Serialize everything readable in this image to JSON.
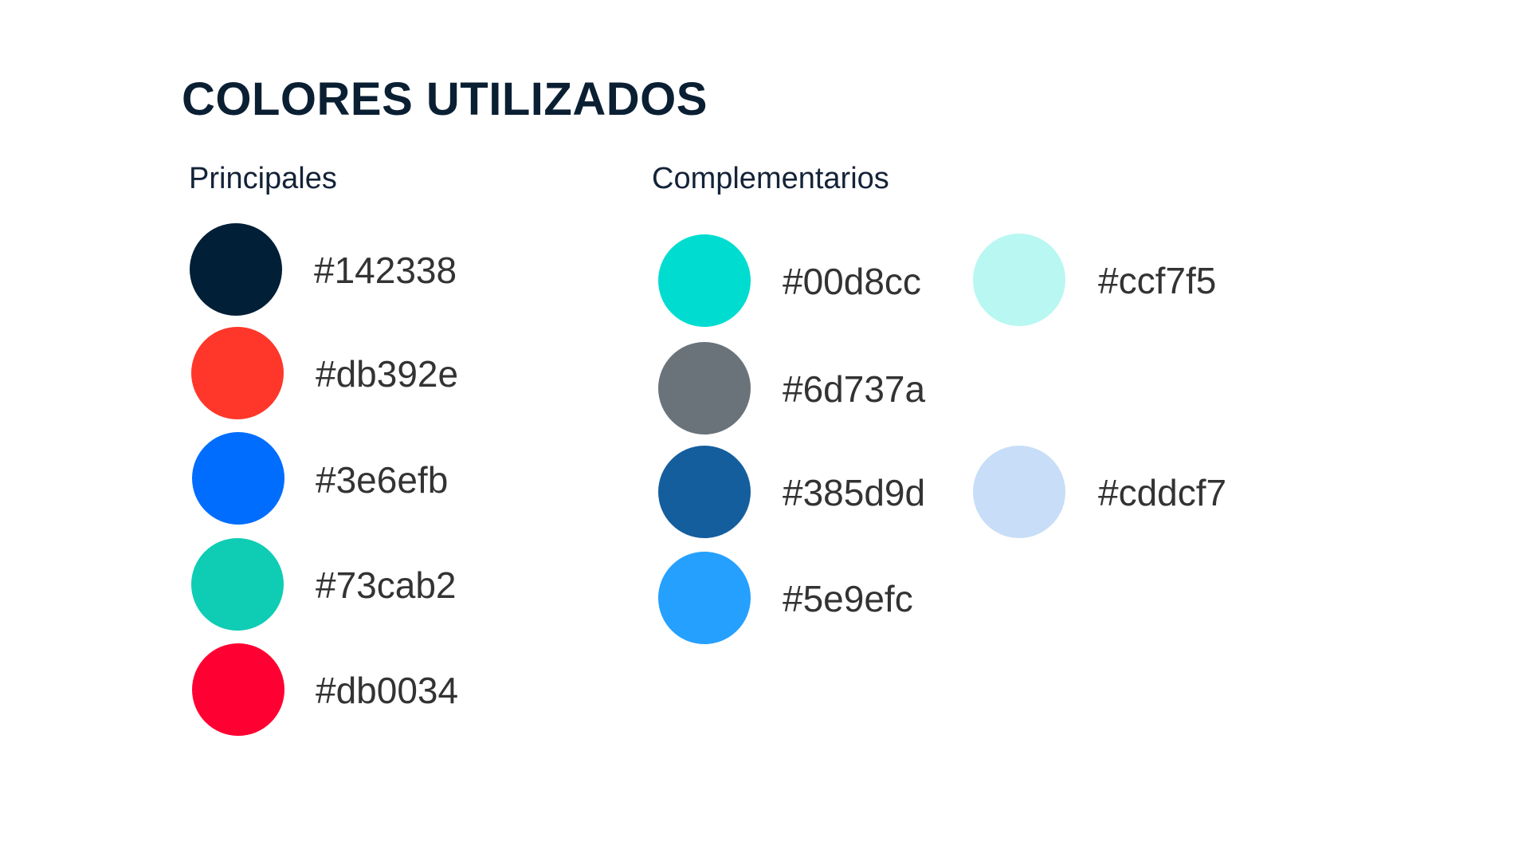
{
  "title": "COLORES UTILIZADOS",
  "principales": {
    "label": "Principales",
    "items": [
      {
        "code": "#142338",
        "swatch": "#011f36"
      },
      {
        "code": "#db392e",
        "swatch": "#ff372b"
      },
      {
        "code": "#3e6efb",
        "swatch": "#006dff"
      },
      {
        "code": "#73cab2",
        "swatch": "#0ecdb4"
      },
      {
        "code": "#db0034",
        "swatch": "#ff0032"
      }
    ]
  },
  "complementarios": {
    "label": "Complementarios",
    "items": [
      {
        "code": "#00d8cc",
        "swatch": "#00dcd0"
      },
      {
        "code": "#6d737a",
        "swatch": "#6b737a"
      },
      {
        "code": "#385d9d",
        "swatch": "#145e9e"
      },
      {
        "code": "#5e9efc",
        "swatch": "#25a0ff"
      },
      {
        "code": "#ccf7f5",
        "swatch": "#b9f7f2"
      },
      {
        "code": "#cddcf7",
        "swatch": "#c8ddf7"
      }
    ]
  }
}
